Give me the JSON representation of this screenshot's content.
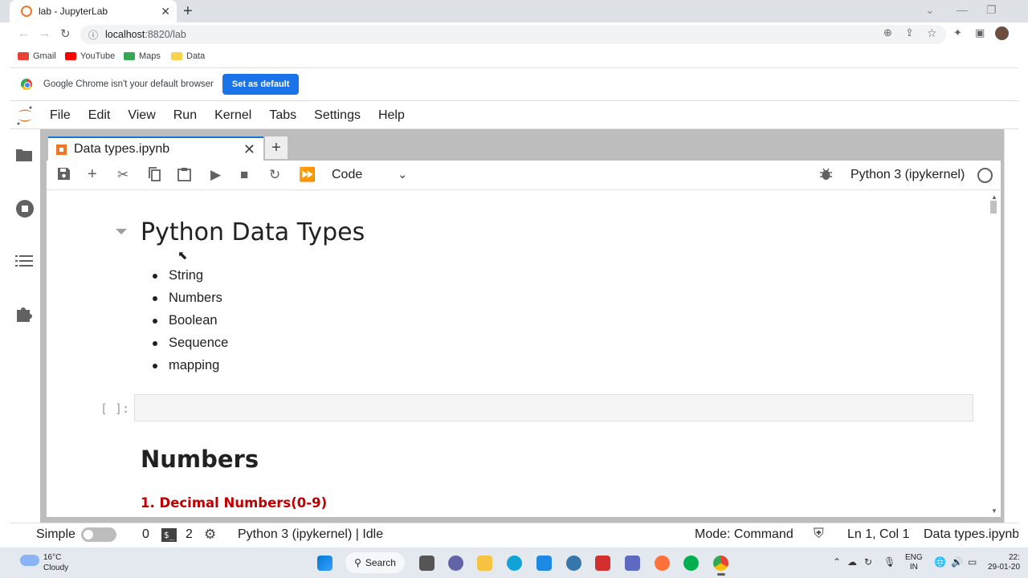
{
  "browser": {
    "tab_title": "lab - JupyterLab",
    "url_host": "localhost",
    "url_path": ":8820/lab",
    "bookmarks": [
      "Gmail",
      "YouTube",
      "Maps",
      "Data"
    ],
    "infobar_text": "Google Chrome isn't your default browser",
    "infobar_button": "Set as default"
  },
  "jupyter": {
    "menu": [
      "File",
      "Edit",
      "View",
      "Run",
      "Kernel",
      "Tabs",
      "Settings",
      "Help"
    ],
    "notebook_tab": "Data types.ipynb",
    "cell_type": "Code",
    "kernel": "Python 3 (ipykernel)",
    "cells": {
      "heading": "Python Data Types",
      "list": [
        "String",
        "Numbers",
        "Boolean",
        "Sequence",
        "mapping"
      ],
      "prompt": "[ ]:",
      "heading2": "Numbers",
      "subheading": "1. Decimal Numbers(0-9)"
    },
    "status": {
      "mode_label": "Simple",
      "count1": "0",
      "terminal_label": "$_",
      "count2": "2",
      "kernel_state": "Python 3 (ipykernel) | Idle",
      "mode": "Mode: Command",
      "position": "Ln 1, Col 1",
      "filename": "Data types.ipynb"
    }
  },
  "taskbar": {
    "weather_temp": "16°C",
    "weather_desc": "Cloudy",
    "search": "Search",
    "lang1": "ENG",
    "lang2": "IN",
    "time": "22:",
    "date": "29-01-20"
  },
  "colors": {
    "jupyter_orange": "#f37626",
    "active_tab": "#1976d2",
    "subheading_red": "#c00000",
    "chrome_blue": "#1a73e8"
  }
}
